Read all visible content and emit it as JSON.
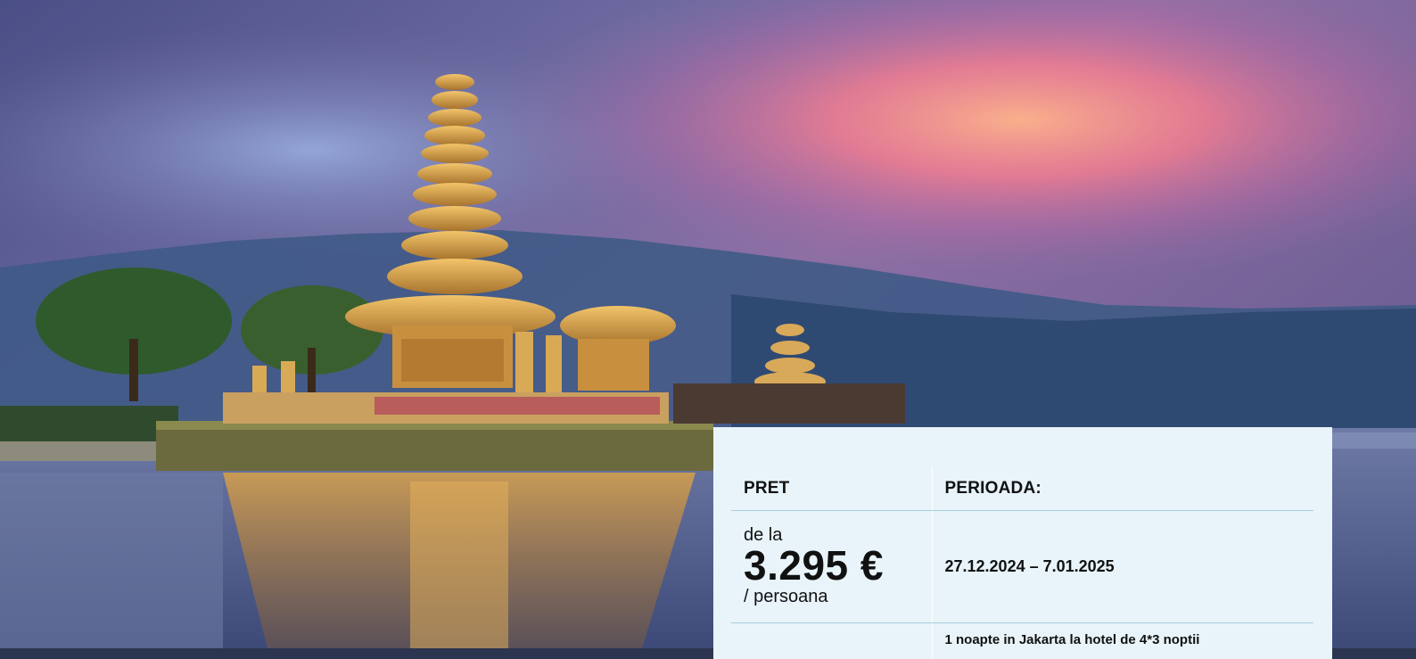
{
  "pricing": {
    "price_header": "PRET",
    "period_header": "PERIOADA:",
    "from_label": "de la",
    "price": "3.295 €",
    "per_person": "/ persoana",
    "period": "27.12.2024 – 7.01.2025",
    "extra_note": "1 noapte in Jakarta la hotel de 4*3 noptii"
  }
}
